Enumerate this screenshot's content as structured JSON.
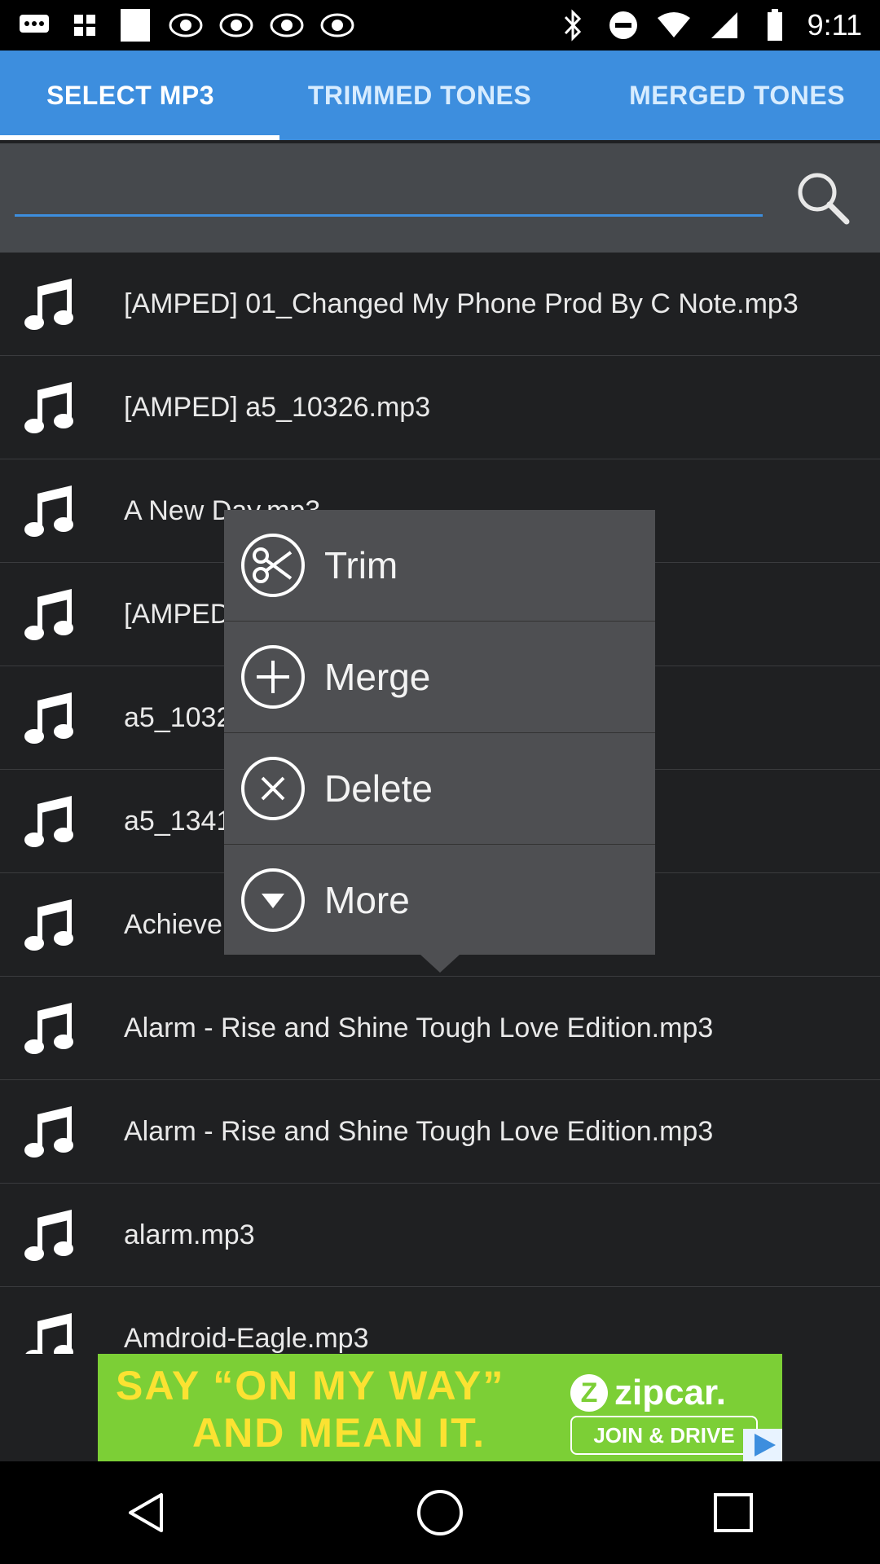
{
  "status_bar": {
    "time": "9:11",
    "left_icons": [
      "message-icon",
      "grid-icon",
      "square-icon",
      "abc13-icon",
      "abc13-icon",
      "abc13-icon",
      "abc13-icon"
    ],
    "right_icons": [
      "bluetooth-icon",
      "do-not-disturb-icon",
      "wifi-icon",
      "signal-icon",
      "battery-icon"
    ]
  },
  "tabs": [
    {
      "label": "SELECT MP3",
      "active": true
    },
    {
      "label": "TRIMMED TONES",
      "active": false
    },
    {
      "label": "MERGED TONES",
      "active": false
    }
  ],
  "search": {
    "placeholder": "",
    "value": "",
    "icon": "search-icon"
  },
  "files": [
    {
      "name": "[AMPED] 01_Changed My Phone Prod By C Note.mp3"
    },
    {
      "name": "[AMPED] a5_10326.mp3"
    },
    {
      "name": "A New Day.mp3"
    },
    {
      "name": "[AMPED"
    },
    {
      "name": "a5_1032"
    },
    {
      "name": "a5_1341"
    },
    {
      "name": "Achieve"
    },
    {
      "name": "Alarm - Rise and Shine Tough Love Edition.mp3"
    },
    {
      "name": "Alarm - Rise and Shine Tough Love Edition.mp3"
    },
    {
      "name": "alarm.mp3"
    },
    {
      "name": "Amdroid-Eagle.mp3"
    }
  ],
  "popup": {
    "items": [
      {
        "label": "Trim",
        "icon": "scissors-icon"
      },
      {
        "label": "Merge",
        "icon": "plus-circle-icon"
      },
      {
        "label": "Delete",
        "icon": "close-circle-icon"
      },
      {
        "label": "More",
        "icon": "chevron-down-circle-icon"
      }
    ]
  },
  "ad": {
    "line1": "SAY “ON MY WAY”",
    "line2": "AND MEAN IT.",
    "brand": "zipcar.",
    "brand_letter": "Z",
    "cta": "JOIN & DRIVE",
    "colors": {
      "background": "#7ccf36",
      "headline": "#fbe232"
    }
  },
  "nav": [
    "back-icon",
    "home-icon",
    "recents-icon"
  ],
  "colors": {
    "accent": "#3d8ede",
    "background": "#1f2022",
    "popup": "#4e4f52"
  }
}
